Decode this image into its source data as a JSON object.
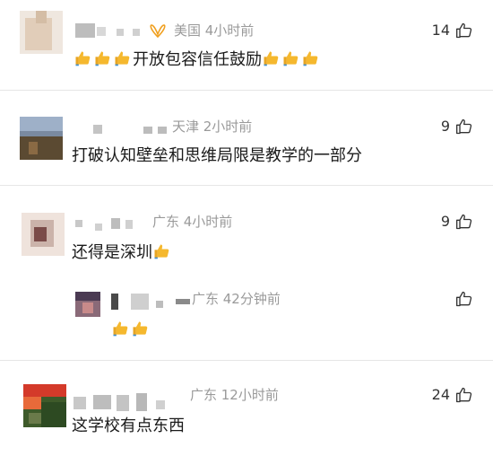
{
  "comments": [
    {
      "location_time": "美国 4小时前",
      "text": "开放包容信任鼓励",
      "likes": "14",
      "emoji_before": 3,
      "emoji_after": 3
    },
    {
      "location_time": "天津 2小时前",
      "text": "打破认知壁垒和思维局限是教学的一部分",
      "likes": "9"
    },
    {
      "location_time": "广东 4小时前",
      "text": "还得是深圳",
      "likes": "9",
      "emoji_after": 1
    },
    {
      "location_time": "广东 42分钟前",
      "text": "",
      "likes": "",
      "emoji_count": 2
    },
    {
      "location_time": "广东 12小时前",
      "text": "这学校有点东西",
      "likes": "24"
    }
  ],
  "icons": {
    "like": "thumbs-up-outline-icon",
    "emoji": "thumbs-up-emoji-icon",
    "vip": "vip-badge-icon"
  },
  "colors": {
    "text": "#1a1a1a",
    "meta": "#9a9a9a",
    "vip": "#f0a020",
    "emoji": "#f5b82e"
  }
}
